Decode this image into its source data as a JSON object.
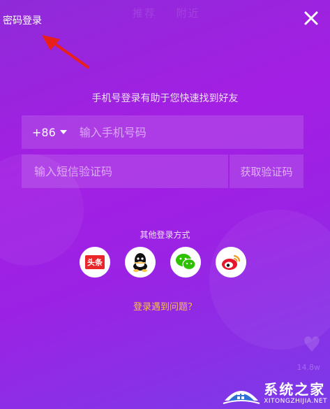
{
  "header": {
    "password_login_label": "密码登录",
    "close_label": "关闭"
  },
  "background": {
    "tab_recommend": "推荐",
    "tab_nearby": "附近",
    "like_count": "14.8w"
  },
  "login_form": {
    "hint_text": "手机号登录有助于您快速找到好友",
    "country_code": "+86",
    "phone_placeholder": "输入手机号码",
    "sms_placeholder": "输入短信验证码",
    "get_code_label": "获取验证码"
  },
  "other_login": {
    "label": "其他登录方式",
    "providers": [
      {
        "name": "toutiao",
        "badge_text": "头条",
        "color": "#e9262a"
      },
      {
        "name": "qq",
        "color": "#000000"
      },
      {
        "name": "wechat",
        "color": "#2dc100"
      },
      {
        "name": "weibo",
        "color": "#e6162d"
      }
    ]
  },
  "help": {
    "problem_label": "登录遇到问题？"
  },
  "watermark": {
    "title": "系统之家",
    "subtitle": "XITONGZHIJIA.NET"
  },
  "colors": {
    "accent_yellow": "#f5c24b",
    "arrow_red": "#e8201c",
    "bg_purple": "#a31fe3"
  }
}
